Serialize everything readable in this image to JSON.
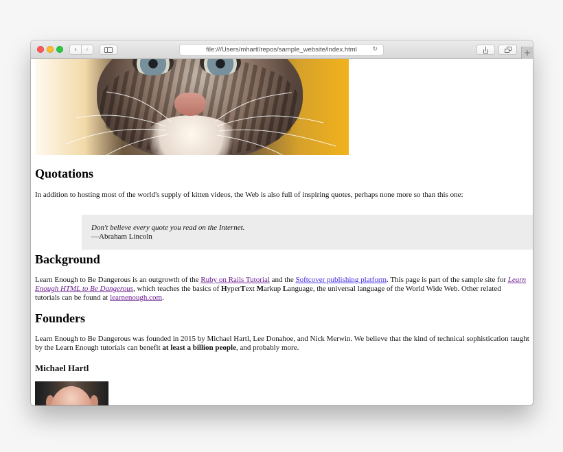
{
  "browser": {
    "address": "file:///Users/mhartl/repos/sample_website/index.html",
    "icons": {
      "back": "chevron-left-icon",
      "forward": "chevron-right-icon",
      "sidebar": "sidebar-icon",
      "reload": "reload-icon",
      "share": "share-icon",
      "tabs": "tabs-icon",
      "new_tab": "plus-icon"
    },
    "glyphs": {
      "back": "‹",
      "forward": "›",
      "reload": "↻",
      "new_tab": "+"
    }
  },
  "page": {
    "quotations": {
      "heading": "Quotations",
      "intro": "In addition to hosting most of the world's supply of kitten videos, the Web is also full of inspiring quotes, perhaps none more so than this one:",
      "quote": "Don't believe every quote you read on the Internet.",
      "author": "—Abraham Lincoln"
    },
    "background": {
      "heading": "Background",
      "text_1": "Learn Enough to Be Dangerous is an outgrowth of the ",
      "link_1": "Ruby on Rails Tutorial",
      "text_2": " and the ",
      "link_2": "Softcover publishing platform",
      "text_3": ". This page is part of the sample site for ",
      "link_3": "Learn Enough HTML to Be Dangerous",
      "text_4": ", which teaches the basics of ",
      "hyper_h": "H",
      "hyper_rest": "yper",
      "text_t": "T",
      "text_rest": "ext ",
      "markup_m": "M",
      "markup_rest": "arkup ",
      "language_l": "L",
      "language_rest": "anguage, the universal language of the World Wide Web. Other related tutorials can be found at ",
      "link_4": "learnenough.com",
      "text_5": "."
    },
    "founders": {
      "heading": "Founders",
      "text_1": "Learn Enough to Be Dangerous was founded in 2015 by Michael Hartl, Lee Donahoe, and Nick Merwin. We believe that the kind of technical sophistication taught by the Learn Enough tutorials can benefit ",
      "emphasis": "at least a billion people",
      "text_2": ", and probably more.",
      "name": "Michael Hartl"
    },
    "colors": {
      "link": "#3f2ae0",
      "visited_link": "#6a1b8f",
      "quote_background": "#ececec"
    }
  }
}
